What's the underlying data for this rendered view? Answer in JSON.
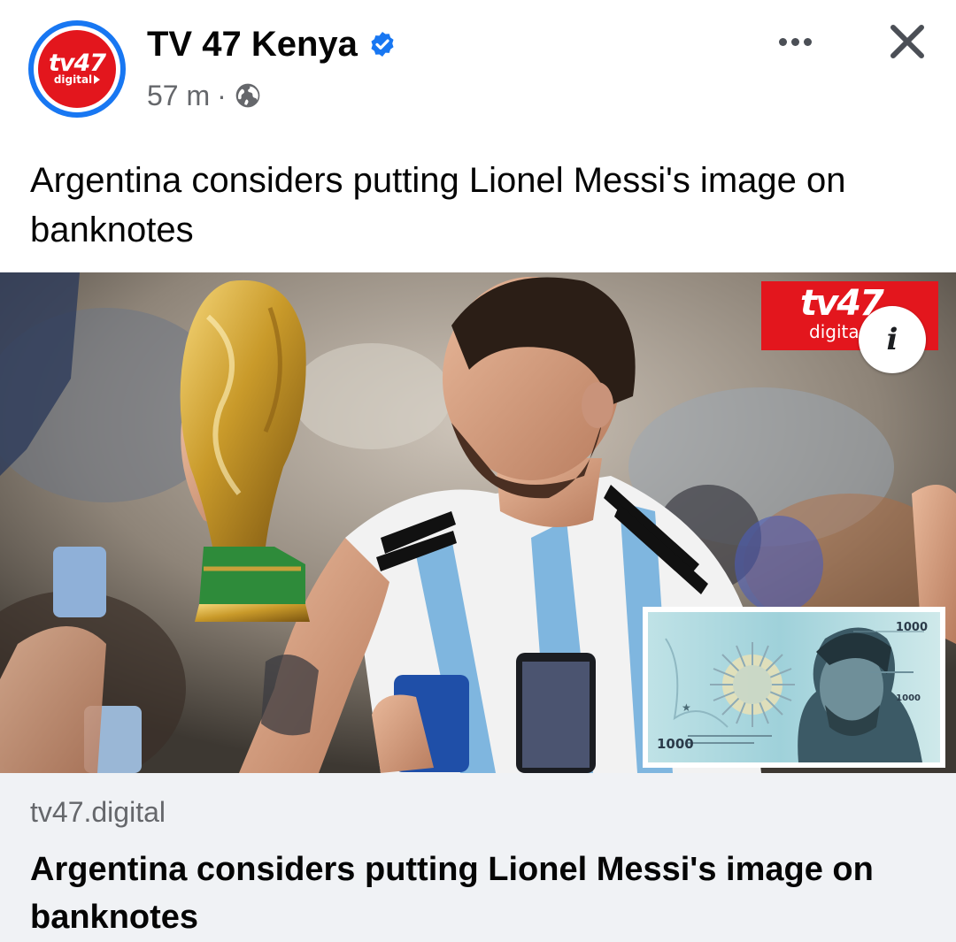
{
  "header": {
    "page_name": "TV 47 Kenya",
    "timestamp": "57 m",
    "separator": "·",
    "privacy_icon": "globe-icon",
    "verified_icon": "verified-badge-icon",
    "more_icon": "more-options-icon",
    "close_icon": "close-icon",
    "avatar": {
      "logo_text": "tv47",
      "logo_subtext": "digital"
    }
  },
  "post": {
    "caption": "Argentina considers putting Lionel Messi's image on banknotes"
  },
  "media": {
    "watermark_logo": "tv47",
    "watermark_subtext": "digita",
    "info_button_label": "i",
    "banknote": {
      "top_value": "1000",
      "bottom_value": "1000",
      "right_value": "1000"
    }
  },
  "link_preview": {
    "domain": "tv47.digital",
    "title": "Argentina considers putting Lionel Messi's image on banknotes"
  },
  "colors": {
    "brand_red": "#e3161d",
    "facebook_blue": "#1877f2",
    "secondary_text": "#65676b",
    "link_box_bg": "#f0f2f5"
  }
}
